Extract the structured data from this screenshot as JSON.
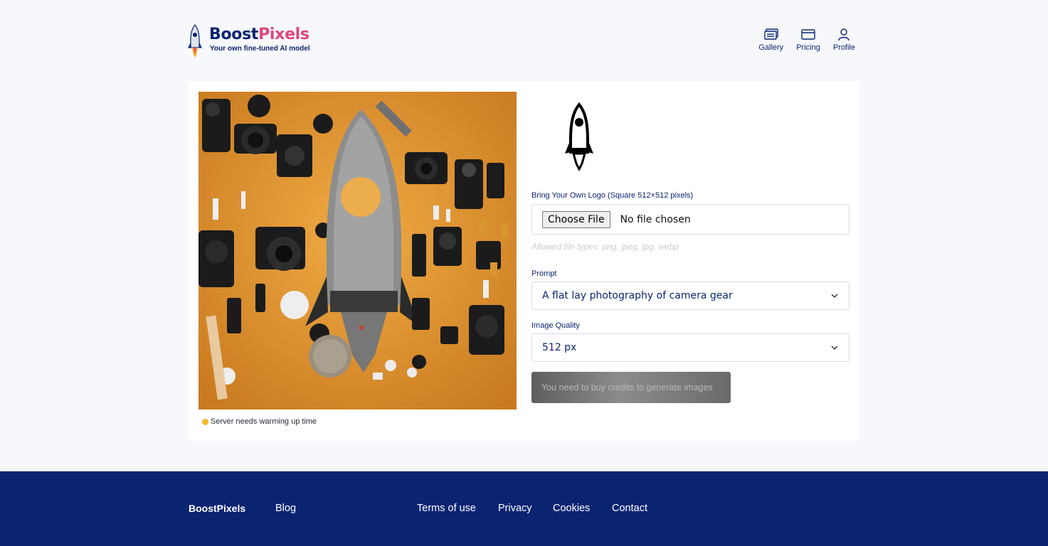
{
  "brand": {
    "name_part1": "Boost",
    "name_part2": "Pixels",
    "tagline": "Your own fine-tuned AI model",
    "colors": {
      "primary": "#0b2472",
      "accent": "#e0457b"
    }
  },
  "nav": [
    {
      "label": "Gallery",
      "icon": "gallery-icon"
    },
    {
      "label": "Pricing",
      "icon": "credit-card-icon"
    },
    {
      "label": "Profile",
      "icon": "user-icon"
    }
  ],
  "preview": {
    "image": "flat lay of camera gear arranged around a rocket shape on orange background",
    "status_text": "Server needs warming up time",
    "status_color": "#f2b92f"
  },
  "form": {
    "logo_label": "Bring Your Own Logo (Square 512×512 pixels)",
    "file_button": "Choose File",
    "file_value": "No file chosen",
    "file_hint": "Allowed file types: png, jpeg, jpg, webp",
    "prompt_label": "Prompt",
    "prompt_value": "A flat lay photography of camera gear",
    "quality_label": "Image Quality",
    "quality_value": "512 px",
    "submit_label": "You need to buy credits to generate images"
  },
  "footer": {
    "brand": "BoostPixels",
    "links": [
      "Blog",
      "Terms of use",
      "Privacy",
      "Cookies",
      "Contact"
    ]
  }
}
